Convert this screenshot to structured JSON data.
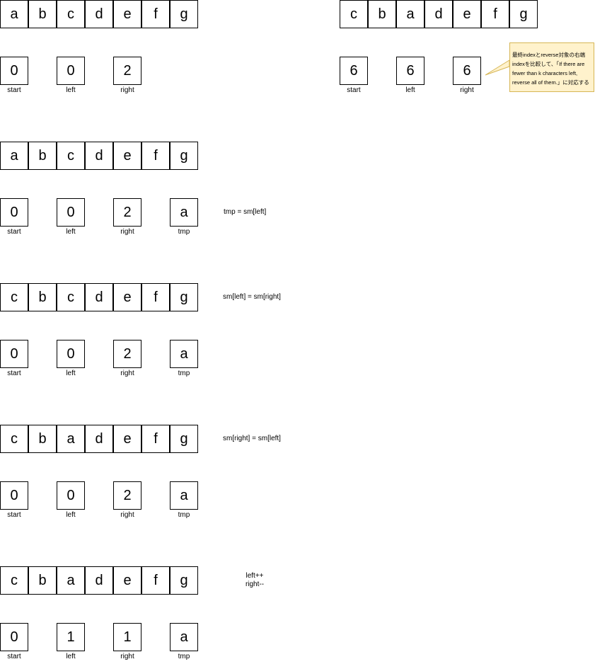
{
  "steps": [
    {
      "array": [
        "a",
        "b",
        "c",
        "d",
        "e",
        "f",
        "g"
      ],
      "vars": [
        {
          "value": "0",
          "label": "start"
        },
        {
          "value": "0",
          "label": "left"
        },
        {
          "value": "2",
          "label": "right"
        }
      ]
    },
    {
      "array": [
        "a",
        "b",
        "c",
        "d",
        "e",
        "f",
        "g"
      ],
      "vars": [
        {
          "value": "0",
          "label": "start"
        },
        {
          "value": "0",
          "label": "left"
        },
        {
          "value": "2",
          "label": "right"
        },
        {
          "value": "a",
          "label": "tmp"
        }
      ],
      "note": "tmp = sm[left]"
    },
    {
      "array": [
        "c",
        "b",
        "c",
        "d",
        "e",
        "f",
        "g"
      ],
      "vars": [
        {
          "value": "0",
          "label": "start"
        },
        {
          "value": "0",
          "label": "left"
        },
        {
          "value": "2",
          "label": "right"
        },
        {
          "value": "a",
          "label": "tmp"
        }
      ],
      "note": "sm[left] = sm[right]"
    },
    {
      "array": [
        "c",
        "b",
        "a",
        "d",
        "e",
        "f",
        "g"
      ],
      "vars": [
        {
          "value": "0",
          "label": "start"
        },
        {
          "value": "0",
          "label": "left"
        },
        {
          "value": "2",
          "label": "right"
        },
        {
          "value": "a",
          "label": "tmp"
        }
      ],
      "note": "sm[right] = sm[left]"
    },
    {
      "array": [
        "c",
        "b",
        "a",
        "d",
        "e",
        "f",
        "g"
      ],
      "vars": [
        {
          "value": "0",
          "label": "start"
        },
        {
          "value": "1",
          "label": "left"
        },
        {
          "value": "1",
          "label": "right"
        },
        {
          "value": "a",
          "label": "tmp"
        }
      ],
      "note_lines": [
        "left++",
        "right--"
      ]
    }
  ],
  "final": {
    "array": [
      "c",
      "b",
      "a",
      "d",
      "e",
      "f",
      "g"
    ],
    "vars": [
      {
        "value": "6",
        "label": "start"
      },
      {
        "value": "6",
        "label": "left"
      },
      {
        "value": "6",
        "label": "right"
      }
    ],
    "callout_lines": [
      "最終indexとreverse対象の右端",
      "indexを比較して、「If there are",
      "fewer than k characters left,",
      "reverse all of them.」に対応する"
    ]
  },
  "colors": {
    "callout_fill": "#fff2cc",
    "callout_border": "#d6b656"
  }
}
